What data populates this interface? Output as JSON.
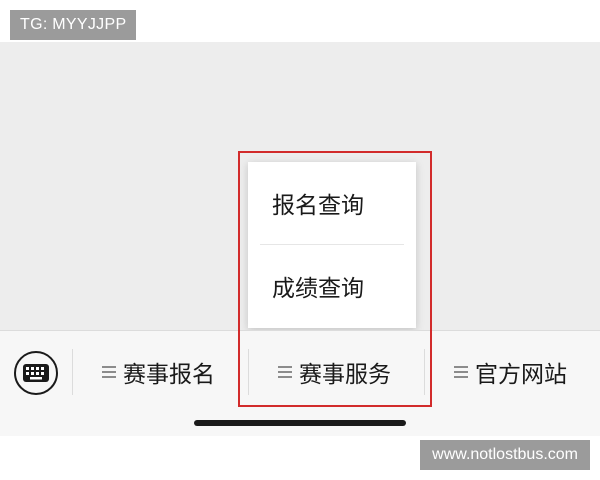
{
  "watermarks": {
    "top_left": "TG: MYYJJPP",
    "bottom_right": "www.notlostbus.com"
  },
  "popup_menu": {
    "items": [
      {
        "label": "报名查询"
      },
      {
        "label": "成绩查询"
      }
    ]
  },
  "menu_bar": {
    "keyboard_icon": "keyboard-icon",
    "items": [
      {
        "label": "赛事报名",
        "icon": "menu-lines-icon"
      },
      {
        "label": "赛事服务",
        "icon": "menu-lines-icon"
      },
      {
        "label": "官方网站",
        "icon": "menu-lines-icon"
      }
    ]
  },
  "colors": {
    "highlight": "#d22b2b",
    "chat_background": "#ededed",
    "menu_bar_background": "#f7f7f7",
    "watermark_background": "#9b9b9b"
  }
}
